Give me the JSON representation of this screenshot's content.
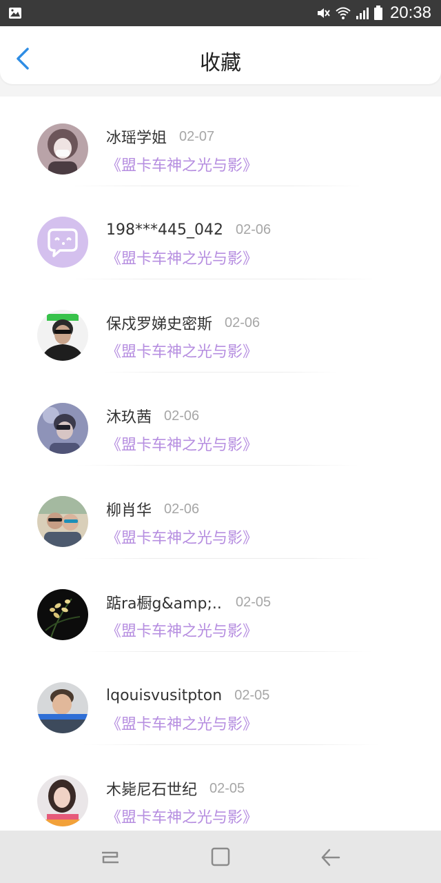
{
  "status_bar": {
    "time": "20:38"
  },
  "header": {
    "title": "收藏"
  },
  "colors": {
    "accent_blue": "#2f8de4",
    "link_purple": "#b68ee0",
    "date_gray": "#a6a6a6"
  },
  "items": [
    {
      "name": "冰瑶学姐",
      "date": "02-07",
      "subtitle": "《盟卡车神之光与影》",
      "avatar": "avatar-girl-photo"
    },
    {
      "name": "198***445_042...",
      "date": "02-06",
      "subtitle": "《盟卡车神之光与影》",
      "avatar": "default-chat-bubble-icon"
    },
    {
      "name": "保戍罗娣史密斯",
      "date": "02-06",
      "subtitle": "《盟卡车神之光与影》",
      "avatar": "avatar-man-sunglasses"
    },
    {
      "name": "沐玖茜",
      "date": "02-06",
      "subtitle": "《盟卡车神之光与影》",
      "avatar": "avatar-boy-photo"
    },
    {
      "name": "柳肖华",
      "date": "02-06",
      "subtitle": "《盟卡车神之光与影》",
      "avatar": "avatar-two-people"
    },
    {
      "name": "踮ra橱g&amp;...",
      "date": "02-05",
      "subtitle": "《盟卡车神之光与影》",
      "avatar": "avatar-orchid-flower"
    },
    {
      "name": "lqouisvusitpton",
      "date": "02-05",
      "subtitle": "《盟卡车神之光与影》",
      "avatar": "avatar-man-photo"
    },
    {
      "name": "木毙尼石世纪",
      "date": "02-05",
      "subtitle": "《盟卡车神之光与影》",
      "avatar": "avatar-woman-photo"
    }
  ]
}
